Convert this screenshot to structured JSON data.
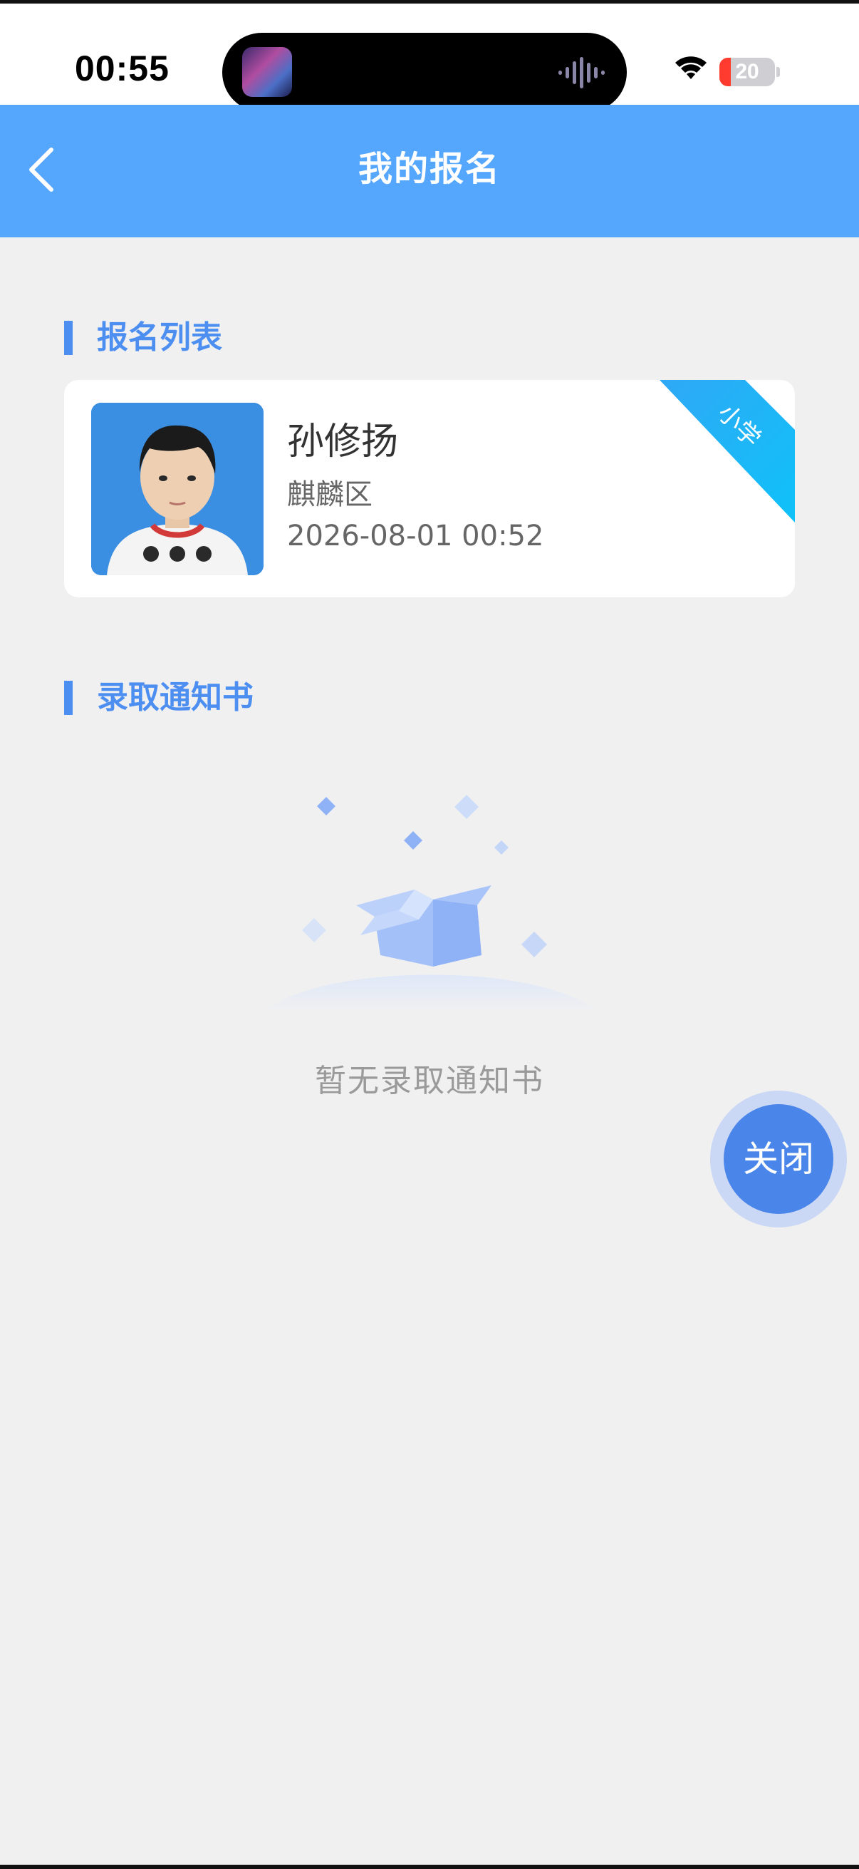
{
  "status_bar": {
    "time": "00:55",
    "battery_level": "20",
    "battery_fraction": 0.2,
    "icons": [
      "wifi-icon",
      "battery-icon",
      "audio-wave-icon"
    ]
  },
  "nav": {
    "title": "我的报名",
    "back_icon": "chevron-left-icon"
  },
  "registration_section": {
    "title": "报名列表",
    "items": [
      {
        "name": "孙修扬",
        "district": "麒麟区",
        "datetime": "2026-08-01 00:52",
        "badge": "小学"
      }
    ]
  },
  "admission_section": {
    "title": "录取通知书",
    "empty_text": "暂无录取通知书",
    "empty_icon": "empty-box-icon"
  },
  "close_button": {
    "label": "关闭"
  },
  "colors": {
    "primary": "#55a6fd",
    "accent": "#4d8ff1",
    "badge": "#22b4f6",
    "fab": "#4a85ea",
    "background": "#f0f0f1"
  }
}
